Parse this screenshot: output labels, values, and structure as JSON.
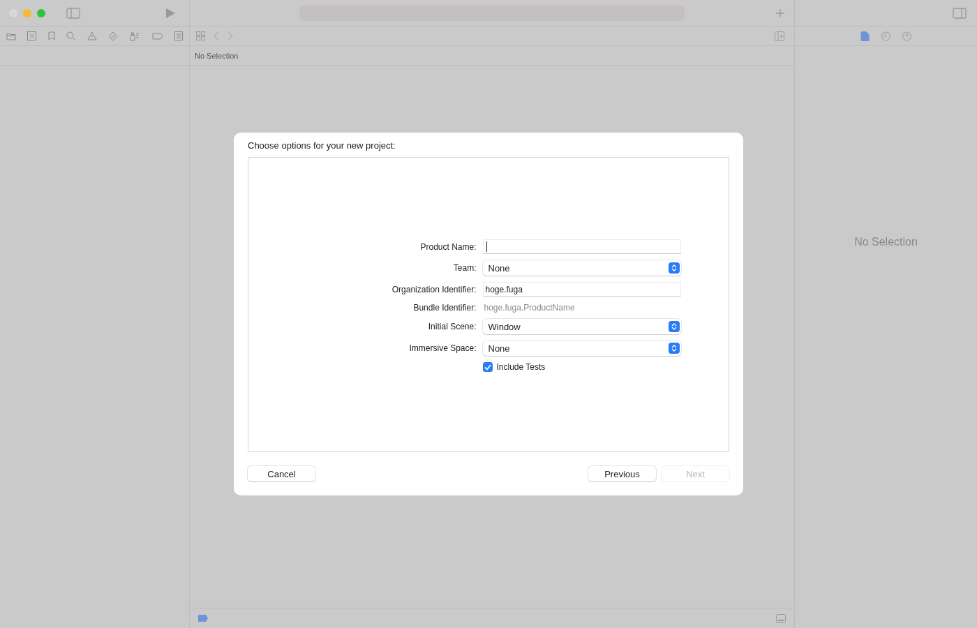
{
  "editor": {
    "path_bar": "No Selection"
  },
  "inspector": {
    "tabs": [
      {
        "selected": true
      },
      {
        "selected": false
      },
      {
        "selected": false
      }
    ],
    "placeholder": "No Selection"
  },
  "dialog": {
    "title": "Choose options for your new project:",
    "fields": [
      {
        "kind": "text",
        "label": "Product Name:",
        "focused": true
      },
      {
        "kind": "popup",
        "label": "Team:",
        "value": "None"
      },
      {
        "kind": "text",
        "label": "Organization Identifier:",
        "value": "hoge.fuga",
        "focused": false
      },
      {
        "kind": "static",
        "label": "Bundle Identifier:",
        "value": "hoge.fuga.ProductName"
      },
      {
        "kind": "popup",
        "label": "Initial Scene:",
        "value": "Window"
      },
      {
        "kind": "popup",
        "label": "Immersive Space:",
        "value": "None"
      },
      {
        "kind": "checkbox",
        "label": "Include Tests",
        "checked": true
      }
    ],
    "buttons": [
      {
        "label": "Cancel",
        "disabled": false
      },
      {
        "label": "Previous",
        "disabled": false
      },
      {
        "label": "Next",
        "disabled": true
      }
    ]
  }
}
